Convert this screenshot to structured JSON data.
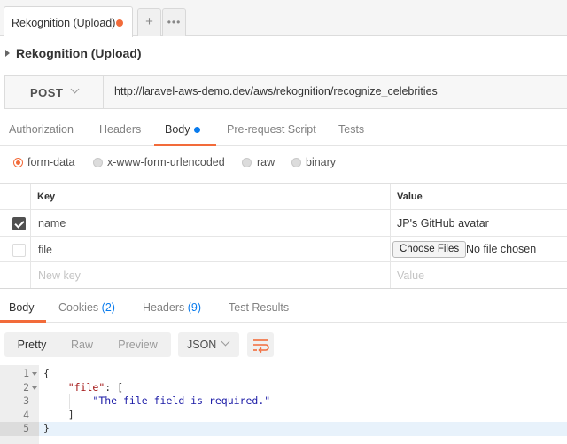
{
  "tabs": {
    "active_label": "Rekognition (Upload)",
    "add_label": "+",
    "more_label": "•••"
  },
  "request": {
    "title": "Rekognition (Upload)",
    "method": "POST",
    "url": "http://laravel-aws-demo.dev/aws/rekognition/recognize_celebrities"
  },
  "request_tabs": [
    {
      "label": "Authorization"
    },
    {
      "label": "Headers"
    },
    {
      "label": "Body",
      "active": true
    },
    {
      "label": "Pre-request Script"
    },
    {
      "label": "Tests"
    }
  ],
  "body_modes": [
    {
      "label": "form-data",
      "selected": true
    },
    {
      "label": "x-www-form-urlencoded"
    },
    {
      "label": "raw"
    },
    {
      "label": "binary"
    }
  ],
  "form_table": {
    "key_header": "Key",
    "value_header": "Value",
    "rows": [
      {
        "checked": true,
        "key": "name",
        "value": "JP's GitHub avatar"
      },
      {
        "checked": false,
        "key": "file",
        "file_button": "Choose Files",
        "file_status": "No file chosen"
      }
    ],
    "new_key_placeholder": "New key",
    "new_value_placeholder": "Value"
  },
  "response_tabs": {
    "body": "Body",
    "cookies": "Cookies",
    "cookies_count": "(2)",
    "headers": "Headers",
    "headers_count": "(9)",
    "test_results": "Test Results"
  },
  "view_modes": [
    "Pretty",
    "Raw",
    "Preview"
  ],
  "language": "JSON",
  "code": {
    "line_numbers": [
      "1",
      "2",
      "3",
      "4",
      "5"
    ],
    "line1": "{",
    "line2_key": "\"file\"",
    "line2_rest": ": [",
    "line3_string": "\"The file field is required.\"",
    "line4": "]",
    "line5": "}"
  },
  "colors": {
    "accent": "#f26b3a",
    "blue": "#097bed"
  }
}
